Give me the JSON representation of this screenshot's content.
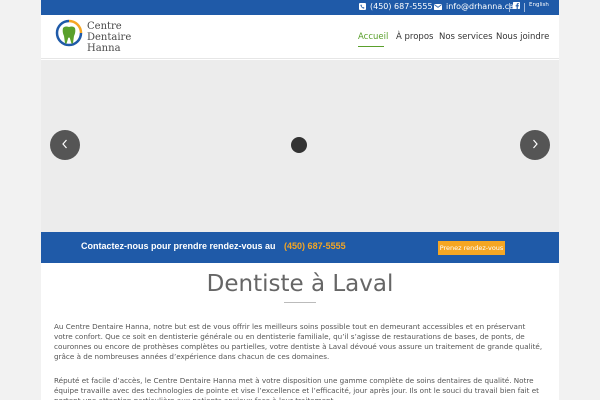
{
  "topbar": {
    "phone": "(450) 687-5555",
    "email": "info@drhanna.ca",
    "language": "English",
    "background": "#1f5aa8"
  },
  "logo": {
    "line1": "Centre",
    "line2": "Dentaire",
    "line3": "Hanna"
  },
  "nav": {
    "items": [
      {
        "label": "Accueil",
        "active": true
      },
      {
        "label": "À propos",
        "active": false
      },
      {
        "label": "Nos services",
        "active": false
      },
      {
        "label": "Nous joindre",
        "active": false
      }
    ],
    "active_color": "#5aa02c"
  },
  "slider": {
    "prev_icon": "chevron-left-icon",
    "next_icon": "chevron-right-icon"
  },
  "banner": {
    "text": "Contactez-nous pour prendre rendez-vous au",
    "phone": "(450) 687-5555",
    "button": "Prenez rendez-vous",
    "accent": "#f5a623"
  },
  "content": {
    "title": "Dentiste à Laval",
    "paragraph1": "Au Centre Dentaire Hanna, notre but est de vous offrir les meilleurs soins possible tout en demeurant accessibles et en préservant votre confort. Que ce soit en dentisterie générale ou en dentisterie familiale, qu’il s’agisse de restaurations de bases, de ponts, de couronnes ou encore de prothèses complètes ou partielles, votre dentiste à Laval dévoué vous assure un traitement de grande qualité, grâce à de nombreuses années d’expérience dans chacun de ces domaines.",
    "paragraph2": "Réputé et facile d’accès, le Centre Dentaire Hanna met à votre disposition une gamme complète de soins dentaires de qualité. Notre équipe travaille avec des technologies de pointe et vise l’excellence et l’efficacité, jour après jour. Ils ont le souci du travail bien fait et portent une attention particulière aux patients anxieux face à leur traitement."
  }
}
